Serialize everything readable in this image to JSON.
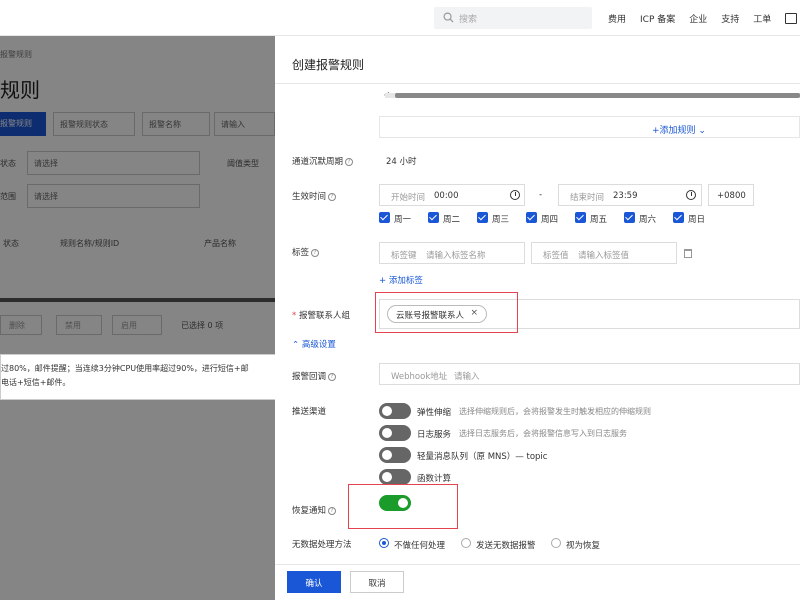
{
  "topbar": {
    "search_placeholder": "搜索",
    "links": [
      "费用",
      "ICP 备案",
      "企业",
      "支持",
      "工单"
    ]
  },
  "bg_page": {
    "breadcrumb": "报警规则",
    "title": "规则",
    "btn_create": "报警规则",
    "filter_status": "报警规则状态",
    "filter_name": "报警名称",
    "filter_name_input": "请输入",
    "label_status": "状态",
    "select_placeholder": "请选择",
    "label_threshold": "阈值类型",
    "label_range": "范围",
    "col_status": "状态",
    "col_rule_name": "规则名称/规则ID",
    "col_product": "产品名称",
    "btn_delete": "删除",
    "btn_disable": "禁用",
    "btn_enable": "启用",
    "selected_count": "已选择 0 项",
    "tooltip_line1": "过80%，邮件提醒；当连续3分钟CPU使用率超过90%，进行短信+邮",
    "tooltip_line2": "电话+短信+邮件。"
  },
  "drawer": {
    "title": "创建报警规则",
    "add_rule": "+添加规则",
    "mute_label": "通道沉默周期",
    "mute_value": "24 小时",
    "effective_label": "生效时间",
    "start_label": "开始时间",
    "start_value": "00:00",
    "time_separator": "-",
    "end_label": "结束时间",
    "end_value": "23:59",
    "timezone": "+0800",
    "days": [
      "周一",
      "周二",
      "周三",
      "周四",
      "周五",
      "周六",
      "周日"
    ],
    "tag_label": "标签",
    "tag_key_label": "标签键",
    "tag_key_placeholder": "请输入标签名称",
    "tag_value_label": "标签值",
    "tag_value_placeholder": "请输入标签值",
    "add_tag": "+ 添加标签",
    "contact_label": "报警联系人组",
    "required_mark": "*",
    "contact_tag": "云账号报警联系人",
    "advanced": "高级设置",
    "callback_label": "报警回调",
    "webhook_label": "Webhook地址",
    "webhook_placeholder": "请输入",
    "push_label": "推送渠道",
    "push_channels": [
      {
        "name": "弹性伸缩",
        "desc": "选择伸缩规则后，会将报警发生时触发相应的伸缩规则"
      },
      {
        "name": "日志服务",
        "desc": "选择日志服务后，会将报警信息写入到日志服务"
      },
      {
        "name": "轻量消息队列（原 MNS）— topic",
        "desc": ""
      },
      {
        "name": "函数计算",
        "desc": ""
      }
    ],
    "recovery_label": "恢复通知",
    "nodata_label": "无数据处理方法",
    "nodata_options": [
      "不做任何处理",
      "发送无数据报警",
      "视为恢复"
    ],
    "nodata_selected": 0,
    "btn_confirm": "确认",
    "btn_cancel": "取消"
  },
  "colors": {
    "primary": "#1a57d6",
    "toggle_on": "#1a9b2a",
    "toggle_off": "#666666",
    "highlight_box": "#e2444f"
  }
}
